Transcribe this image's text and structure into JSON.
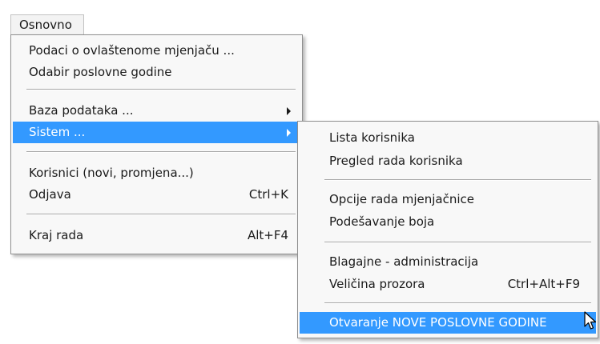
{
  "menubar": {
    "osnovno_label": "Osnovno"
  },
  "main_menu": {
    "items": [
      {
        "label": "Podaci o ovlaštenome mjenjaču ...",
        "shortcut": ""
      },
      {
        "label": "Odabir poslovne godine",
        "shortcut": ""
      },
      {
        "label": "Baza podataka ...",
        "shortcut": ""
      },
      {
        "label": "Sistem ...",
        "shortcut": ""
      },
      {
        "label": "Korisnici (novi, promjena...)",
        "shortcut": ""
      },
      {
        "label": "Odjava",
        "shortcut": "Ctrl+K"
      },
      {
        "label": "Kraj rada",
        "shortcut": "Alt+F4"
      }
    ]
  },
  "submenu_sistem": {
    "items": [
      {
        "label": "Lista korisnika",
        "shortcut": ""
      },
      {
        "label": "Pregled rada korisnika",
        "shortcut": ""
      },
      {
        "label": "Opcije rada mjenjačnice",
        "shortcut": ""
      },
      {
        "label": "Podešavanje boja",
        "shortcut": ""
      },
      {
        "label": "Blagajne - administracija",
        "shortcut": ""
      },
      {
        "label": "Veličina prozora",
        "shortcut": "Ctrl+Alt+F9"
      },
      {
        "label": "Otvaranje NOVE POSLOVNE GODINE",
        "shortcut": ""
      }
    ]
  },
  "colors": {
    "highlight": "#3399ff",
    "menu_background": "#f8f8f8",
    "menu_border": "#8f8f8f"
  },
  "icons": {
    "submenu_arrow": "chevron-right-icon",
    "cursor": "mouse-pointer-icon"
  }
}
